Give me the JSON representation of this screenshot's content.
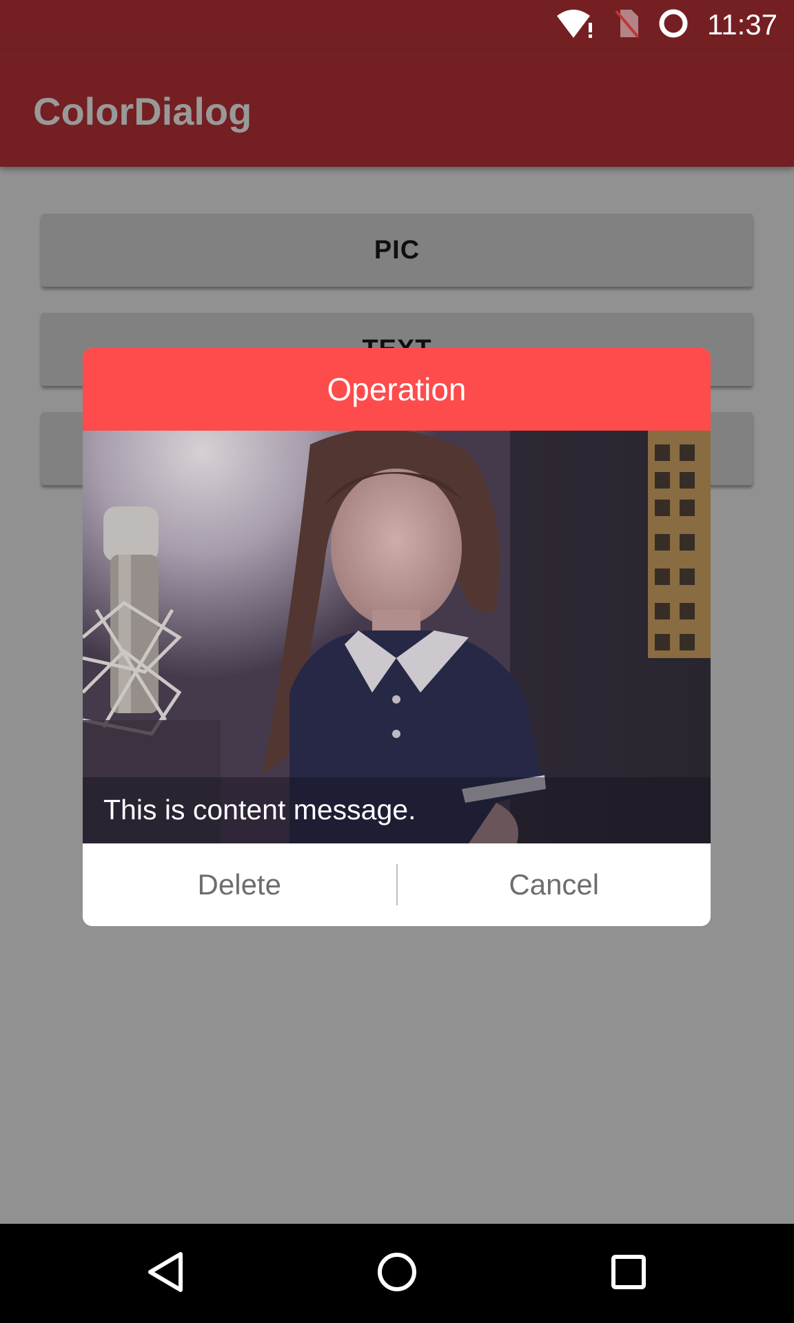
{
  "status_bar": {
    "time": "11:37",
    "icons": [
      "wifi-alert-icon",
      "no-sim-icon",
      "sync-circle-icon"
    ]
  },
  "app_bar": {
    "title": "ColorDialog"
  },
  "main": {
    "buttons": [
      {
        "label": "PIC"
      },
      {
        "label": "TEXT"
      },
      {
        "label": ""
      }
    ]
  },
  "dialog": {
    "title": "Operation",
    "image": "singer-with-microphone-photo",
    "content_message": "This is content message.",
    "actions": {
      "positive_label": "Delete",
      "negative_label": "Cancel"
    }
  },
  "nav_bar": {
    "icons": [
      "back-icon",
      "home-icon",
      "recents-icon"
    ]
  },
  "colors": {
    "app_bar": "#c1353a",
    "dialog_header": "#fe4b4b",
    "scrim": "rgba(0,0,0,0.40)"
  }
}
